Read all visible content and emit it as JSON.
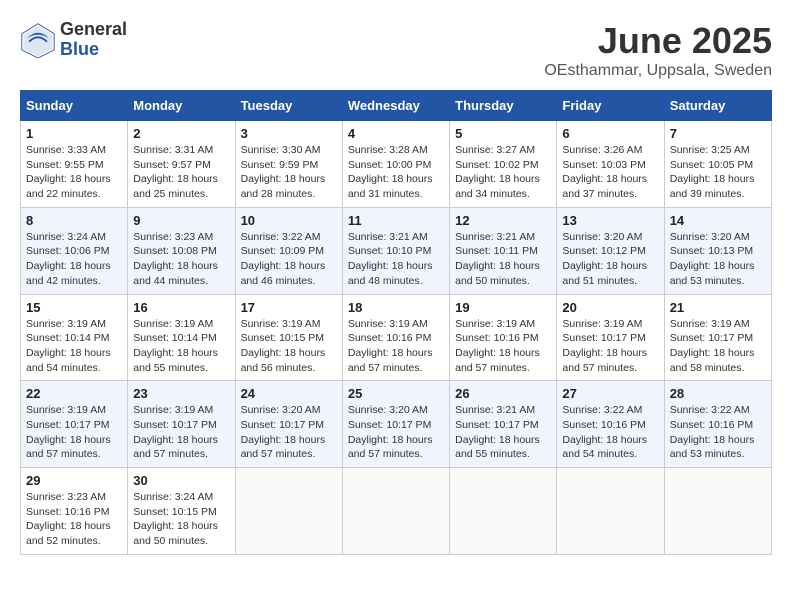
{
  "header": {
    "logo_general": "General",
    "logo_blue": "Blue",
    "month_title": "June 2025",
    "location": "OEsthammar, Uppsala, Sweden"
  },
  "weekdays": [
    "Sunday",
    "Monday",
    "Tuesday",
    "Wednesday",
    "Thursday",
    "Friday",
    "Saturday"
  ],
  "weeks": [
    [
      {
        "day": "1",
        "sunrise": "3:33 AM",
        "sunset": "9:55 PM",
        "daylight": "18 hours and 22 minutes."
      },
      {
        "day": "2",
        "sunrise": "3:31 AM",
        "sunset": "9:57 PM",
        "daylight": "18 hours and 25 minutes."
      },
      {
        "day": "3",
        "sunrise": "3:30 AM",
        "sunset": "9:59 PM",
        "daylight": "18 hours and 28 minutes."
      },
      {
        "day": "4",
        "sunrise": "3:28 AM",
        "sunset": "10:00 PM",
        "daylight": "18 hours and 31 minutes."
      },
      {
        "day": "5",
        "sunrise": "3:27 AM",
        "sunset": "10:02 PM",
        "daylight": "18 hours and 34 minutes."
      },
      {
        "day": "6",
        "sunrise": "3:26 AM",
        "sunset": "10:03 PM",
        "daylight": "18 hours and 37 minutes."
      },
      {
        "day": "7",
        "sunrise": "3:25 AM",
        "sunset": "10:05 PM",
        "daylight": "18 hours and 39 minutes."
      }
    ],
    [
      {
        "day": "8",
        "sunrise": "3:24 AM",
        "sunset": "10:06 PM",
        "daylight": "18 hours and 42 minutes."
      },
      {
        "day": "9",
        "sunrise": "3:23 AM",
        "sunset": "10:08 PM",
        "daylight": "18 hours and 44 minutes."
      },
      {
        "day": "10",
        "sunrise": "3:22 AM",
        "sunset": "10:09 PM",
        "daylight": "18 hours and 46 minutes."
      },
      {
        "day": "11",
        "sunrise": "3:21 AM",
        "sunset": "10:10 PM",
        "daylight": "18 hours and 48 minutes."
      },
      {
        "day": "12",
        "sunrise": "3:21 AM",
        "sunset": "10:11 PM",
        "daylight": "18 hours and 50 minutes."
      },
      {
        "day": "13",
        "sunrise": "3:20 AM",
        "sunset": "10:12 PM",
        "daylight": "18 hours and 51 minutes."
      },
      {
        "day": "14",
        "sunrise": "3:20 AM",
        "sunset": "10:13 PM",
        "daylight": "18 hours and 53 minutes."
      }
    ],
    [
      {
        "day": "15",
        "sunrise": "3:19 AM",
        "sunset": "10:14 PM",
        "daylight": "18 hours and 54 minutes."
      },
      {
        "day": "16",
        "sunrise": "3:19 AM",
        "sunset": "10:14 PM",
        "daylight": "18 hours and 55 minutes."
      },
      {
        "day": "17",
        "sunrise": "3:19 AM",
        "sunset": "10:15 PM",
        "daylight": "18 hours and 56 minutes."
      },
      {
        "day": "18",
        "sunrise": "3:19 AM",
        "sunset": "10:16 PM",
        "daylight": "18 hours and 57 minutes."
      },
      {
        "day": "19",
        "sunrise": "3:19 AM",
        "sunset": "10:16 PM",
        "daylight": "18 hours and 57 minutes."
      },
      {
        "day": "20",
        "sunrise": "3:19 AM",
        "sunset": "10:17 PM",
        "daylight": "18 hours and 57 minutes."
      },
      {
        "day": "21",
        "sunrise": "3:19 AM",
        "sunset": "10:17 PM",
        "daylight": "18 hours and 58 minutes."
      }
    ],
    [
      {
        "day": "22",
        "sunrise": "3:19 AM",
        "sunset": "10:17 PM",
        "daylight": "18 hours and 57 minutes."
      },
      {
        "day": "23",
        "sunrise": "3:19 AM",
        "sunset": "10:17 PM",
        "daylight": "18 hours and 57 minutes."
      },
      {
        "day": "24",
        "sunrise": "3:20 AM",
        "sunset": "10:17 PM",
        "daylight": "18 hours and 57 minutes."
      },
      {
        "day": "25",
        "sunrise": "3:20 AM",
        "sunset": "10:17 PM",
        "daylight": "18 hours and 57 minutes."
      },
      {
        "day": "26",
        "sunrise": "3:21 AM",
        "sunset": "10:17 PM",
        "daylight": "18 hours and 55 minutes."
      },
      {
        "day": "27",
        "sunrise": "3:22 AM",
        "sunset": "10:16 PM",
        "daylight": "18 hours and 54 minutes."
      },
      {
        "day": "28",
        "sunrise": "3:22 AM",
        "sunset": "10:16 PM",
        "daylight": "18 hours and 53 minutes."
      }
    ],
    [
      {
        "day": "29",
        "sunrise": "3:23 AM",
        "sunset": "10:16 PM",
        "daylight": "18 hours and 52 minutes."
      },
      {
        "day": "30",
        "sunrise": "3:24 AM",
        "sunset": "10:15 PM",
        "daylight": "18 hours and 50 minutes."
      },
      null,
      null,
      null,
      null,
      null
    ]
  ]
}
